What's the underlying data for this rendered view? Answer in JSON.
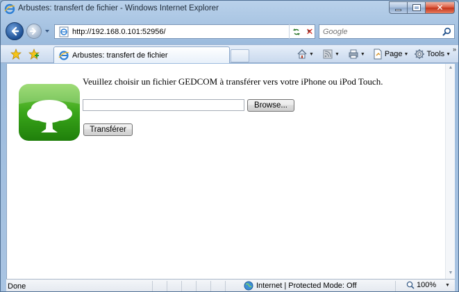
{
  "window": {
    "title": "Arbustes: transfert de fichier - Windows Internet Explorer",
    "caption_buttons": {
      "minimize_icon": "minimize-icon",
      "maximize_icon": "maximize-icon",
      "close_icon": "close-icon"
    }
  },
  "address_bar": {
    "url": "http://192.168.0.101:52956/",
    "search_placeholder": "Google",
    "icons": [
      "back-arrow-icon",
      "forward-arrow-icon",
      "page-favicon",
      "refresh-icon",
      "stop-icon",
      "search-icon"
    ]
  },
  "command_bar": {
    "tab_title": "Arbustes: transfert de fichier",
    "page_label": "Page",
    "tools_label": "Tools",
    "icons": [
      "favorites-star-icon",
      "add-favorites-icon",
      "home-icon",
      "feeds-icon",
      "print-icon",
      "page-icon",
      "tools-gear-icon"
    ]
  },
  "content": {
    "prompt": "Veuillez choisir un fichier GEDCOM à transférer vers votre iPhone ou iPod Touch.",
    "file_path_value": "",
    "browse_label": "Browse...",
    "upload_label": "Transférer",
    "logo_icon": "tree-app-logo"
  },
  "status_bar": {
    "status": "Done",
    "zone": "Internet | Protected Mode: Off",
    "zoom": "100%"
  },
  "colors": {
    "title_bar": "#b9d1ea",
    "logo_green": "#3aa61a",
    "close_button": "#c2331a"
  }
}
